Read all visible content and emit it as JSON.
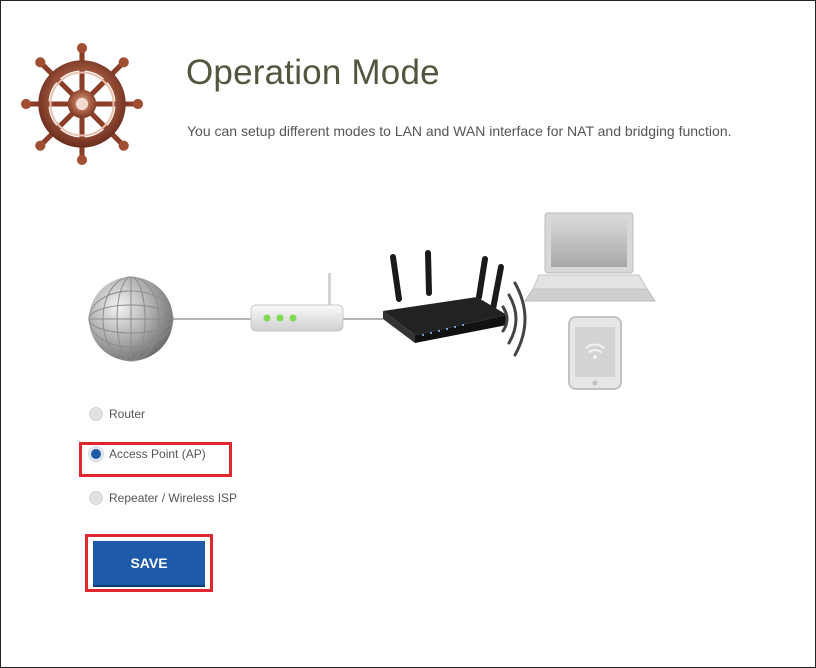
{
  "page": {
    "title": "Operation Mode",
    "description": "You can setup different modes to LAN and WAN interface for NAT and bridging function."
  },
  "logo": {
    "icon": "ship-wheel-icon"
  },
  "diagram": {
    "icons": [
      "globe-icon",
      "modem-icon",
      "router-icon",
      "wifi-waves-icon",
      "laptop-icon",
      "tablet-icon"
    ]
  },
  "modes": {
    "selected": "Access Point (AP)",
    "options": [
      "Router",
      "Access Point (AP)",
      "Repeater / Wireless ISP"
    ]
  },
  "actions": {
    "save_label": "SAVE"
  },
  "colors": {
    "title": "#55553f",
    "primary_button": "#1d5aa9",
    "highlight": "#e0262f",
    "radio_selected": "#1c5aa8"
  }
}
